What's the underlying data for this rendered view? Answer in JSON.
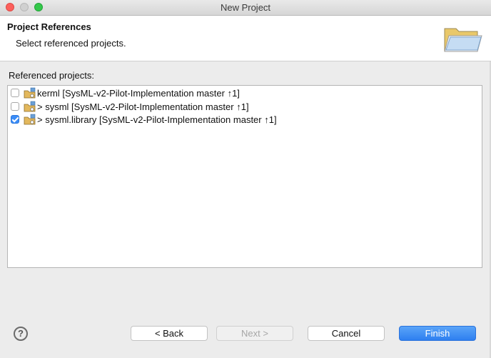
{
  "window": {
    "title": "New Project"
  },
  "header": {
    "title": "Project References",
    "description": "Select referenced projects.",
    "icon": "open-folder-icon"
  },
  "list": {
    "label": "Referenced projects:",
    "items": [
      {
        "text": "kerml [SysML-v2-Pilot-Implementation master ↑1]",
        "checked": false,
        "icon": "project-icon"
      },
      {
        "text": "> sysml [SysML-v2-Pilot-Implementation master ↑1]",
        "checked": false,
        "icon": "project-icon"
      },
      {
        "text": "> sysml.library [SysML-v2-Pilot-Implementation master ↑1]",
        "checked": true,
        "icon": "project-icon"
      }
    ]
  },
  "buttons": {
    "help": "?",
    "back": "< Back",
    "next": "Next >",
    "cancel": "Cancel",
    "finish": "Finish"
  },
  "colors": {
    "accent": "#3b8df7",
    "primary_button": "#2e7ff0"
  }
}
